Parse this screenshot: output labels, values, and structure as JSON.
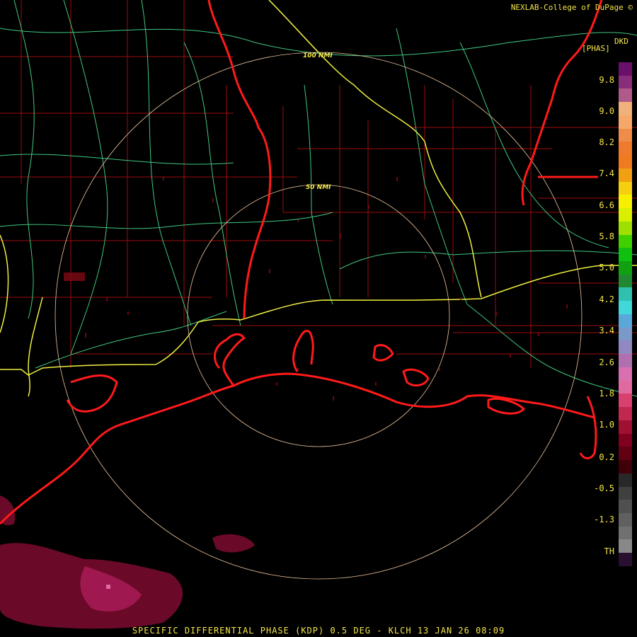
{
  "credit": "NEXLAB-College of DuPage ©",
  "legend": {
    "product": "DKD",
    "unit": "[PHAS]",
    "ticks": [
      "9.8",
      "9.0",
      "8.2",
      "7.4",
      "6.6",
      "5.8",
      "5.0",
      "4.2",
      "3.4",
      "2.6",
      "1.8",
      "1.0",
      "0.2",
      "-0.5",
      "-1.3",
      "TH"
    ],
    "colors": [
      "#6a0f6a",
      "#8a2d7a",
      "#b05a8a",
      "#f0b27a",
      "#f6a86a",
      "#f08c4a",
      "#ee7a2e",
      "#f07a20",
      "#f0a010",
      "#f4d010",
      "#f6f000",
      "#d8f000",
      "#a0e000",
      "#40d000",
      "#10c010",
      "#10a010",
      "#208830",
      "#30c0b0",
      "#40d8d8",
      "#5aa8d8",
      "#7a98c8",
      "#9088c0",
      "#b070b0",
      "#d870b0",
      "#e06aa0",
      "#d84070",
      "#c02850",
      "#a01030",
      "#800020",
      "#600010",
      "#400008",
      "#282828",
      "#404040",
      "#505050",
      "#606060",
      "#707070",
      "#888888",
      "#2a1030"
    ]
  },
  "rings": {
    "inner_label": "50 NMI",
    "outer_label": "100 NMI"
  },
  "footer": "SPECIFIC DIFFERENTIAL PHASE (KDP) 0.5 DEG - KLCH 13 JAN 26 08:09",
  "colors": {
    "coast": "#ff1a1a",
    "county": "#c01010",
    "highway": "#40c880",
    "interstate": "#f0f040",
    "ring": "#f0c8a0"
  }
}
